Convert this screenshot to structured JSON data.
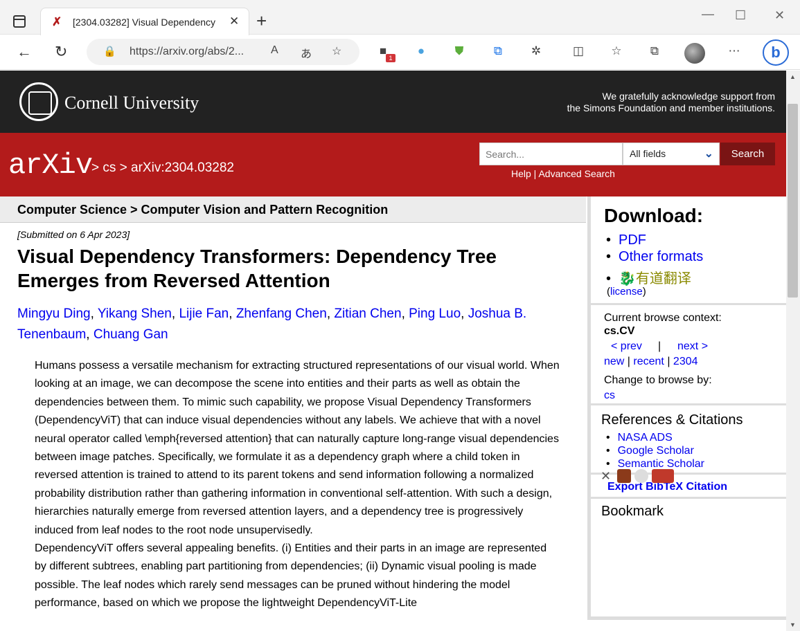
{
  "browser": {
    "tab_title": "[2304.03282] Visual Dependency",
    "url": "https://arxiv.org/abs/2...",
    "ext_badge": "1"
  },
  "header": {
    "cornell_name": "Cornell University",
    "ack_line1": "We gratefully acknowledge support from",
    "ack_line2": "the Simons Foundation and member institutions.",
    "logo_text": "arXiv",
    "breadcrumb": "> cs > arXiv:2304.03282",
    "search_placeholder": "Search...",
    "field_select": "All fields",
    "search_button": "Search",
    "help_link": "Help",
    "link_sep": " | ",
    "advanced_link": "Advanced Search"
  },
  "paper": {
    "subject": "Computer Science > Computer Vision and Pattern Recognition",
    "submitted": "[Submitted on 6 Apr 2023]",
    "title": "Visual Dependency Transformers: Dependency Tree Emerges from Reversed Attention",
    "authors": [
      "Mingyu Ding",
      "Yikang Shen",
      "Lijie Fan",
      "Zhenfang Chen",
      "Zitian Chen",
      "Ping Luo",
      "Joshua B. Tenenbaum",
      "Chuang Gan"
    ],
    "abstract_p1": "Humans possess a versatile mechanism for extracting structured representations of our visual world. When looking at an image, we can decompose the scene into entities and their parts as well as obtain the dependencies between them. To mimic such capability, we propose Visual Dependency Transformers (DependencyViT) that can induce visual dependencies without any labels. We achieve that with a novel neural operator called \\emph{reversed attention} that can naturally capture long-range visual dependencies between image patches. Specifically, we formulate it as a dependency graph where a child token in reversed attention is trained to attend to its parent tokens and send information following a normalized probability distribution rather than gathering information in conventional self-attention. With such a design, hierarchies naturally emerge from reversed attention layers, and a dependency tree is progressively induced from leaf nodes to the root node unsupervisedly.",
    "abstract_p2": "DependencyViT offers several appealing benefits. (i) Entities and their parts in an image are represented by different subtrees, enabling part partitioning from dependencies; (ii) Dynamic visual pooling is made possible. The leaf nodes which rarely send messages can be pruned without hindering the model performance, based on which we propose the lightweight DependencyViT-Lite"
  },
  "sidebar": {
    "download_heading": "Download:",
    "pdf": "PDF",
    "other_formats": "Other formats",
    "youdao": "有道翻译",
    "license_open": "(",
    "license": "license",
    "license_close": ")",
    "context_label": "Current browse context:",
    "context_value": "cs.CV",
    "prev": "< prev",
    "pipe": "|",
    "next": "next >",
    "new": "new",
    "sep": " | ",
    "recent": "recent",
    "month": "2304",
    "change_label": "Change to browse by:",
    "cs": "cs",
    "refs_heading": "References & Citations",
    "nasa": "NASA ADS",
    "google": "Google Scholar",
    "semantic": "Semantic Scholar",
    "bibtex": "Export BibTeX Citation",
    "bookmark_heading": "Bookmark"
  }
}
